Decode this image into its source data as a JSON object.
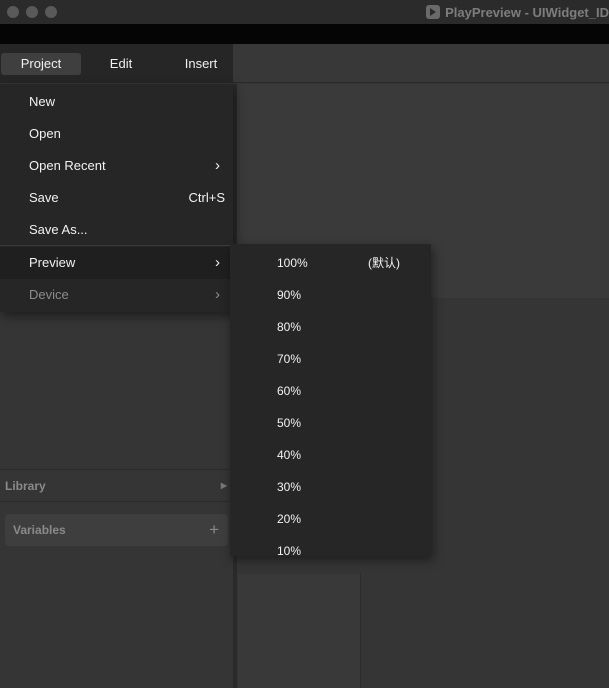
{
  "window": {
    "title": "PlayPreview - UIWidget_ID",
    "app_icon": "play-icon"
  },
  "menubar": {
    "project": "Project",
    "edit": "Edit",
    "insert": "Insert"
  },
  "project_menu": {
    "new": "New",
    "open": "Open",
    "open_recent": "Open Recent",
    "save": "Save",
    "save_shortcut": "Ctrl+S",
    "save_as": "Save As...",
    "preview": "Preview",
    "device": "Device"
  },
  "preview_submenu": {
    "items": [
      "100%",
      "90%",
      "80%",
      "70%",
      "60%",
      "50%",
      "40%",
      "30%",
      "20%",
      "10%"
    ],
    "default_label": "(默认)"
  },
  "panels": {
    "library": "Library",
    "variables": "Variables",
    "variables_add": "+"
  }
}
